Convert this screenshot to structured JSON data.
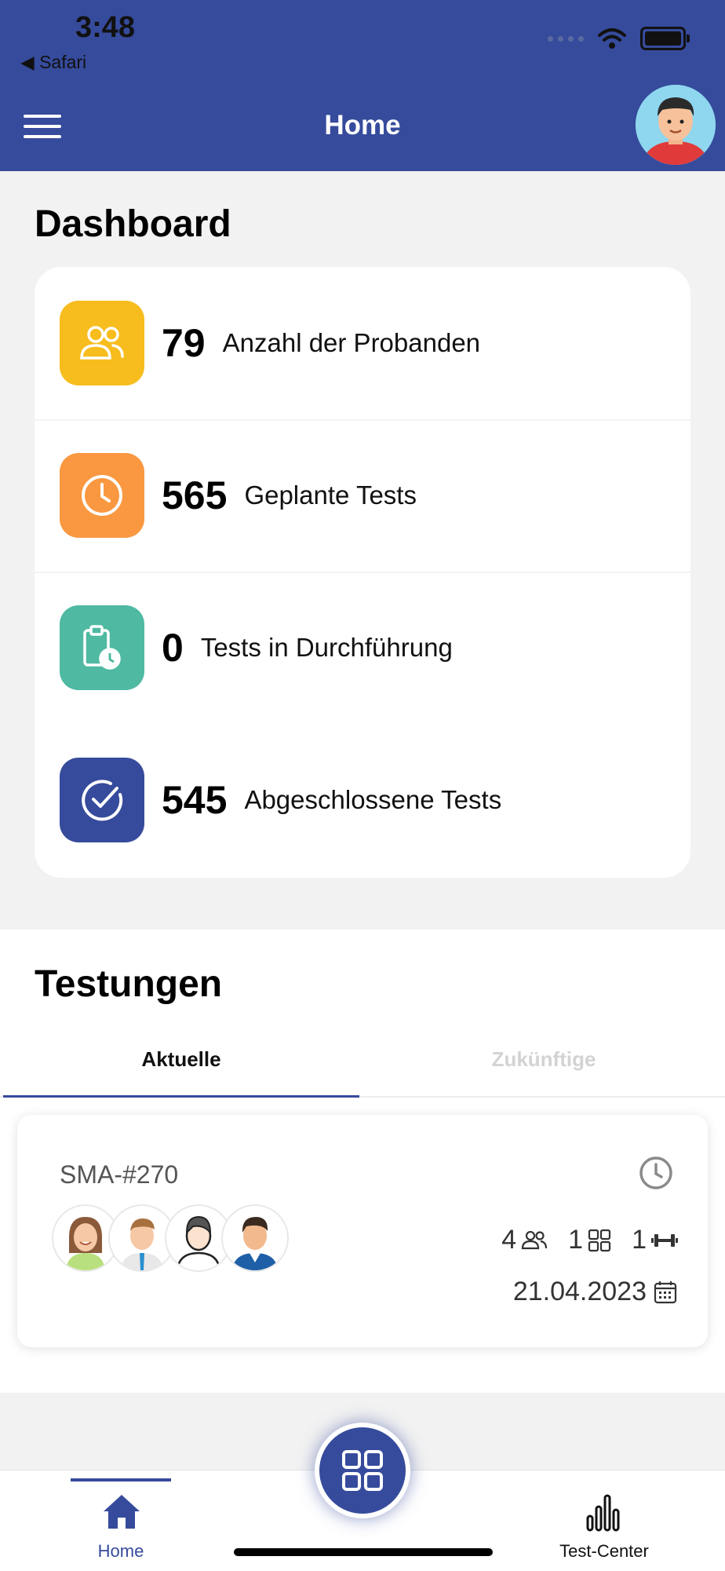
{
  "status_bar": {
    "time": "3:48",
    "back_app": "◀ Safari"
  },
  "header": {
    "title": "Home"
  },
  "dashboard": {
    "title": "Dashboard",
    "items": [
      {
        "value": "79",
        "label": "Anzahl der Probanden",
        "icon": "users-icon",
        "color": "#f7bd1e"
      },
      {
        "value": "565",
        "label": "Geplante Tests",
        "icon": "clock-icon",
        "color": "#f99840"
      },
      {
        "value": "0",
        "label": "Tests in Durchführung",
        "icon": "clipboard-clock-icon",
        "color": "#4fb9a2"
      },
      {
        "value": "545",
        "label": "Abgeschlossene Tests",
        "icon": "check-circle-icon",
        "color": "#364b9c"
      }
    ]
  },
  "testungen": {
    "title": "Testungen",
    "tabs": [
      {
        "label": "Aktuelle",
        "active": true
      },
      {
        "label": "Zukünftige",
        "active": false
      }
    ],
    "cards": [
      {
        "id": "SMA-#270",
        "participants": "4",
        "stations": "1",
        "equipment": "1",
        "date": "21.04.2023"
      }
    ]
  },
  "bottom_nav": {
    "home_label": "Home",
    "test_center_label": "Test-Center"
  },
  "colors": {
    "primary": "#364b9c"
  }
}
